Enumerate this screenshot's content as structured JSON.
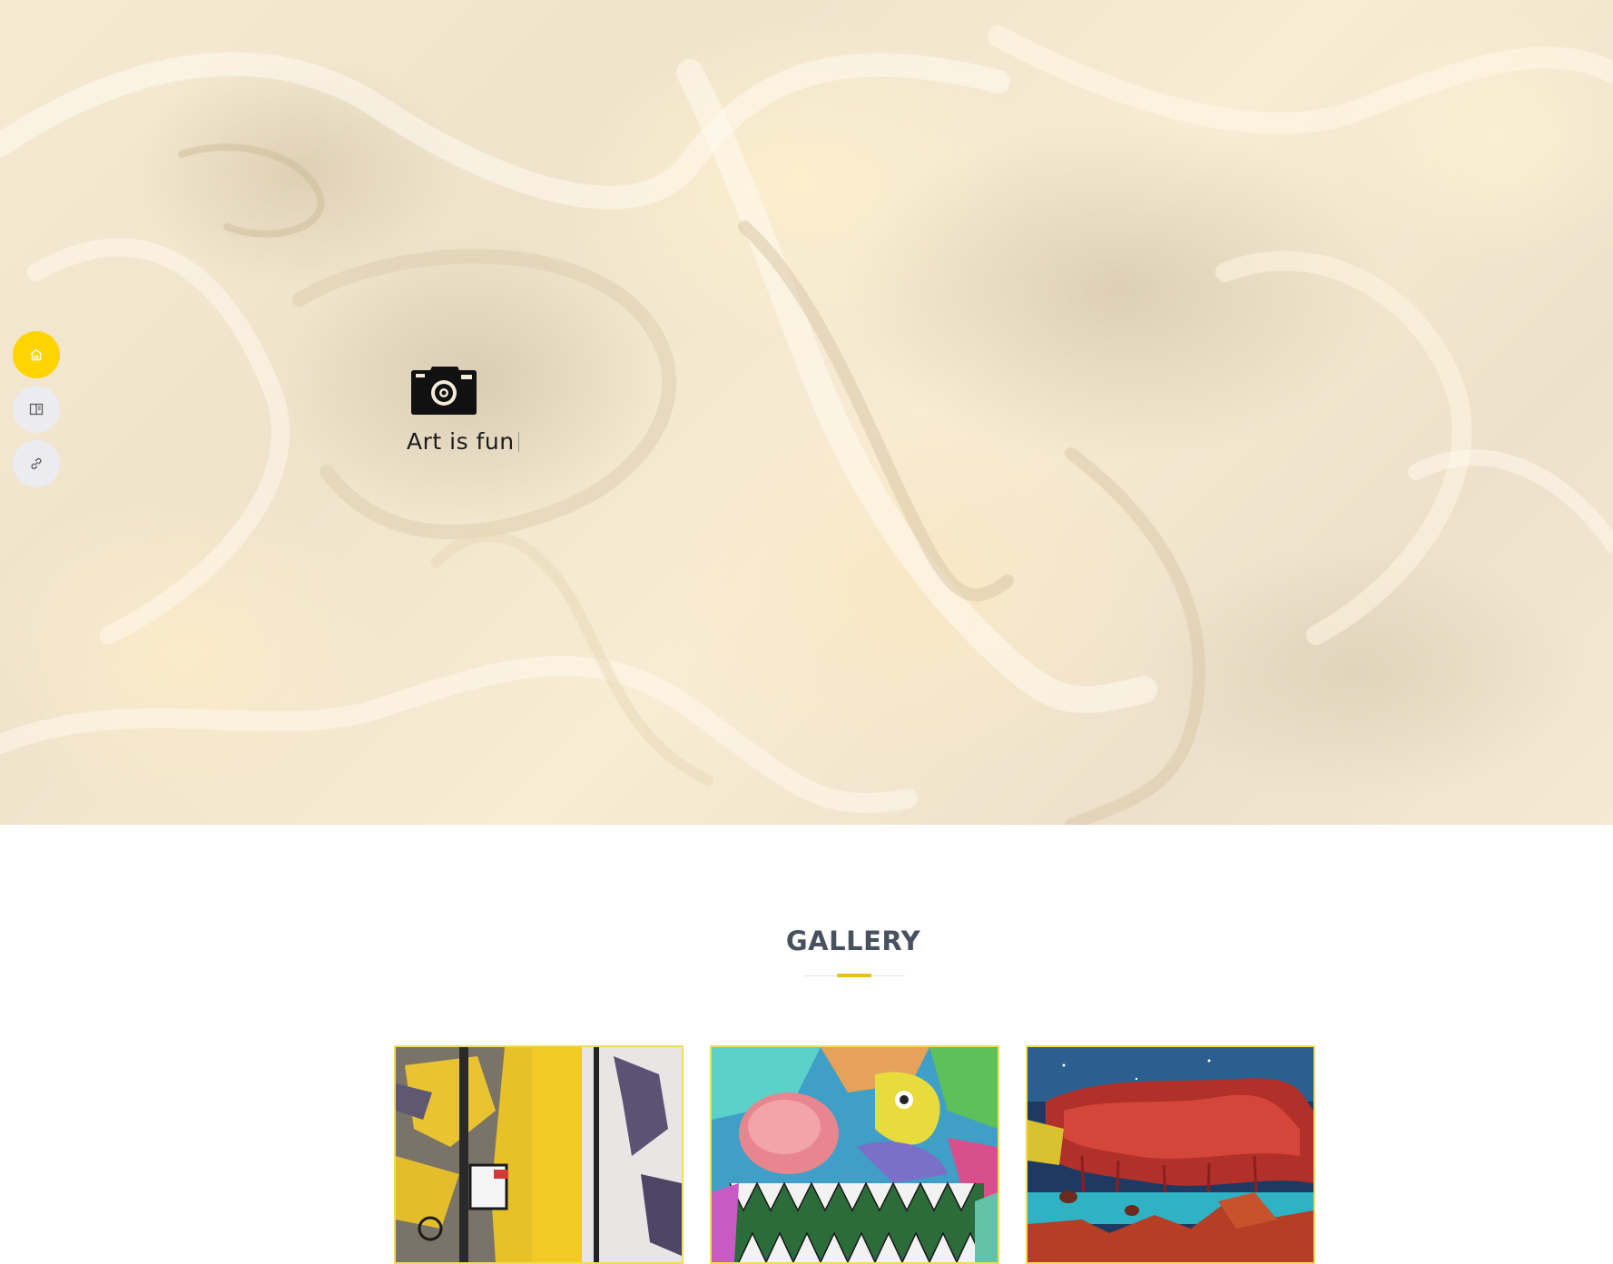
{
  "hero": {
    "tagline": "Art is fun",
    "logo_icon": "camera-icon"
  },
  "side_nav": {
    "items": [
      {
        "name": "home",
        "icon": "home-icon",
        "active": true
      },
      {
        "name": "book",
        "icon": "book-icon",
        "active": false
      },
      {
        "name": "link",
        "icon": "link-icon",
        "active": false
      }
    ]
  },
  "gallery": {
    "title": "GALLERY",
    "items": [
      {
        "name": "yellow-abstract-graffiti"
      },
      {
        "name": "colorful-monster-graffiti"
      },
      {
        "name": "red-space-rock-painting"
      }
    ]
  },
  "colors": {
    "accent": "#ffd400",
    "title": "#47515f",
    "frame": "#f1dc52"
  }
}
